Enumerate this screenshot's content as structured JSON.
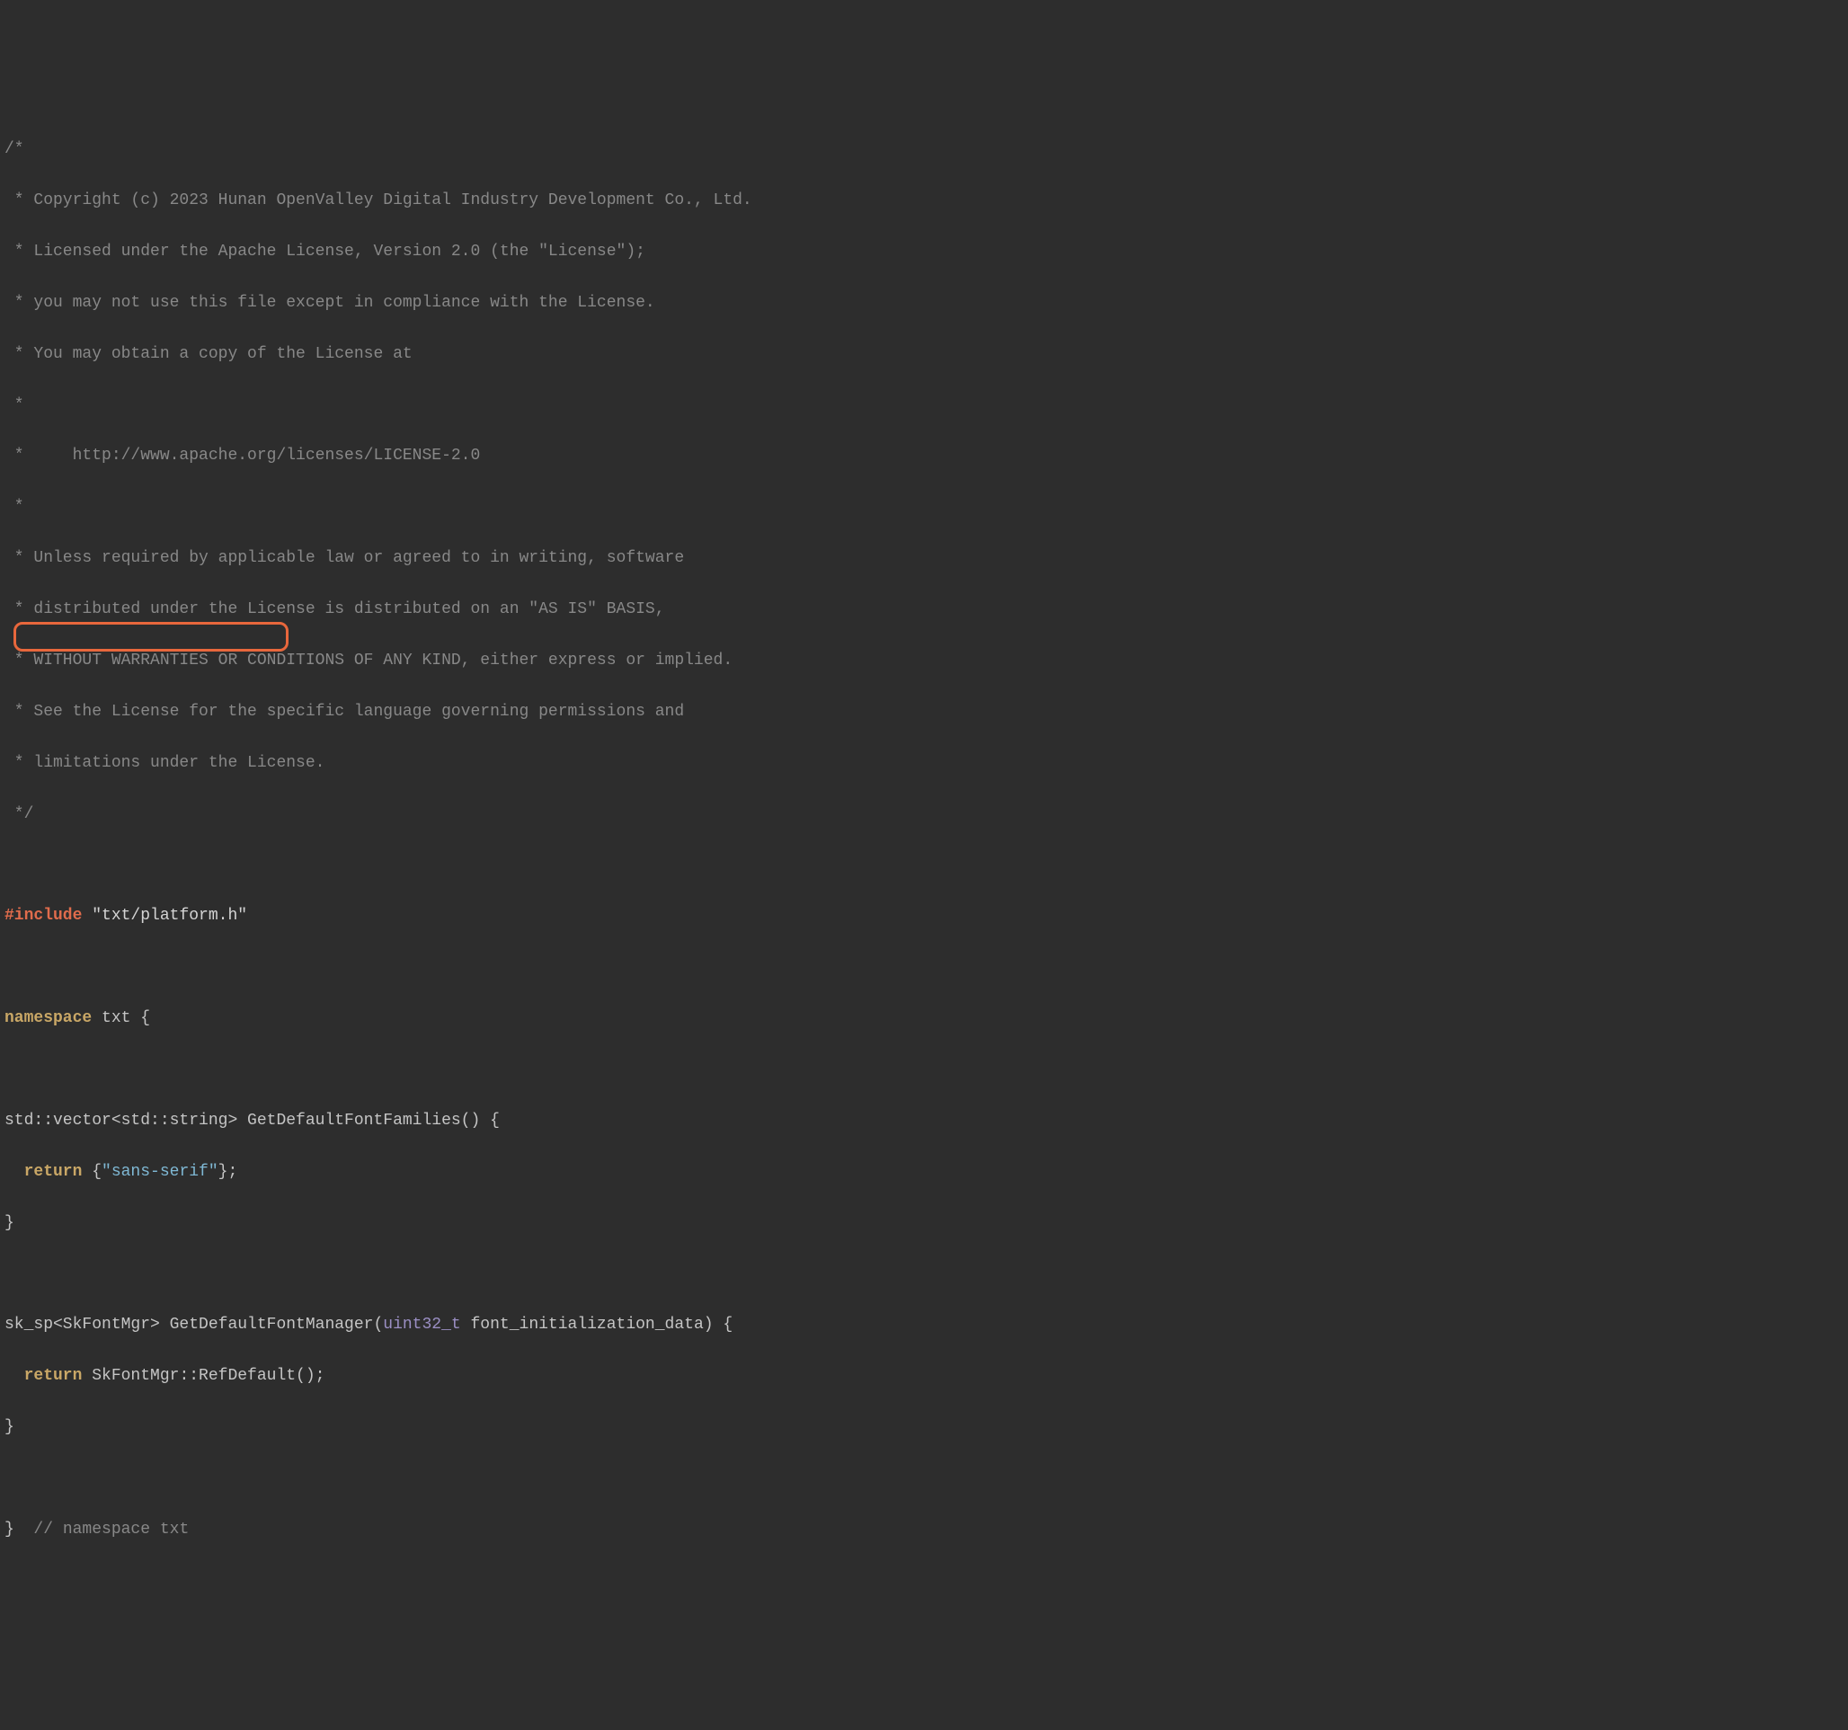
{
  "code": {
    "line1": "/*",
    "line2": " * Copyright (c) 2023 Hunan OpenValley Digital Industry Development Co., Ltd.",
    "line3": " * Licensed under the Apache License, Version 2.0 (the \"License\");",
    "line4": " * you may not use this file except in compliance with the License.",
    "line5": " * You may obtain a copy of the License at",
    "line6": " *",
    "line7": " *     http://www.apache.org/licenses/LICENSE-2.0",
    "line8": " *",
    "line9": " * Unless required by applicable law or agreed to in writing, software",
    "line10": " * distributed under the License is distributed on an \"AS IS\" BASIS,",
    "line11": " * WITHOUT WARRANTIES OR CONDITIONS OF ANY KIND, either express or implied.",
    "line12": " * See the License for the specific language governing permissions and",
    "line13": " * limitations under the License.",
    "line14": " */",
    "include_keyword": "#include",
    "include_path": " \"txt/platform.h\"",
    "namespace_keyword": "namespace",
    "namespace_rest": " txt {",
    "func1_signature": "std::vector<std::string> GetDefaultFontFamilies() {",
    "return_keyword1": "  return",
    "return_brace1": " {",
    "string_literal1": "\"sans-serif\"",
    "return_close1": "};",
    "close_brace1": "}",
    "func2_part1": "sk_sp<SkFontMgr> GetDefaultFontManager(",
    "uint32_type": "uint32_t",
    "func2_part2": " font_initialization_data) {",
    "return_keyword2": "  return",
    "return_rest2": " SkFontMgr::RefDefault();",
    "close_brace2": "}",
    "close_brace3": "}",
    "end_comment": "  // namespace txt"
  },
  "highlight": {
    "top": "568",
    "left": "10",
    "width": "306",
    "height": "33"
  }
}
